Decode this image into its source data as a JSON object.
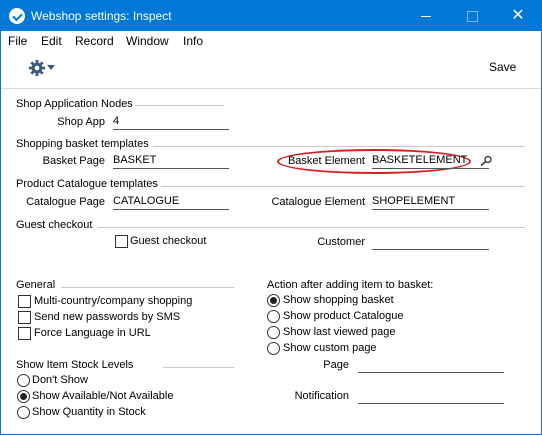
{
  "window": {
    "title": "Webshop settings: Inspect",
    "controls": {
      "minimize": "",
      "maximize": "",
      "close": "✕"
    }
  },
  "menu": [
    "File",
    "Edit",
    "Record",
    "Window",
    "Info"
  ],
  "toolbar": {
    "save_label": "Save",
    "gear_icon": "gear-icon"
  },
  "shop_app_nodes": {
    "heading": "Shop Application Nodes",
    "shop_app_label": "Shop App",
    "shop_app_value": "4"
  },
  "basket_templates": {
    "heading": "Shopping basket templates",
    "basket_page_label": "Basket Page",
    "basket_page_value": "BASKET",
    "basket_element_label": "Basket Element",
    "basket_element_value": "BASKETELEMENT"
  },
  "catalogue_templates": {
    "heading": "Product Catalogue templates",
    "catalogue_page_label": "Catalogue Page",
    "catalogue_page_value": "CATALOGUE",
    "catalogue_element_label": "Catalogue Element",
    "catalogue_element_value": "SHOPELEMENT"
  },
  "guest_checkout": {
    "heading": "Guest checkout",
    "checkbox_label": "Guest checkout",
    "checked": false,
    "customer_label": "Customer",
    "customer_value": ""
  },
  "general": {
    "heading": "General",
    "options": [
      {
        "label": "Multi-country/company shopping",
        "checked": false
      },
      {
        "label": "Send new passwords by SMS",
        "checked": false
      },
      {
        "label": "Force Language in URL",
        "checked": false
      }
    ]
  },
  "stock_levels": {
    "heading": "Show Item Stock Levels",
    "options": [
      {
        "label": "Don't Show",
        "selected": false
      },
      {
        "label": "Show Available/Not Available",
        "selected": true
      },
      {
        "label": "Show Quantity in Stock",
        "selected": false
      }
    ]
  },
  "after_add": {
    "heading": "Action after adding item to basket:",
    "options": [
      {
        "label": "Show shopping basket",
        "selected": true
      },
      {
        "label": "Show product Catalogue",
        "selected": false
      },
      {
        "label": "Show last viewed page",
        "selected": false
      },
      {
        "label": "Show custom page",
        "selected": false
      }
    ],
    "page_label": "Page",
    "page_value": "",
    "notification_label": "Notification",
    "notification_value": ""
  },
  "colors": {
    "titlebar": "#0078d7",
    "highlight_oval": "#d42020"
  }
}
